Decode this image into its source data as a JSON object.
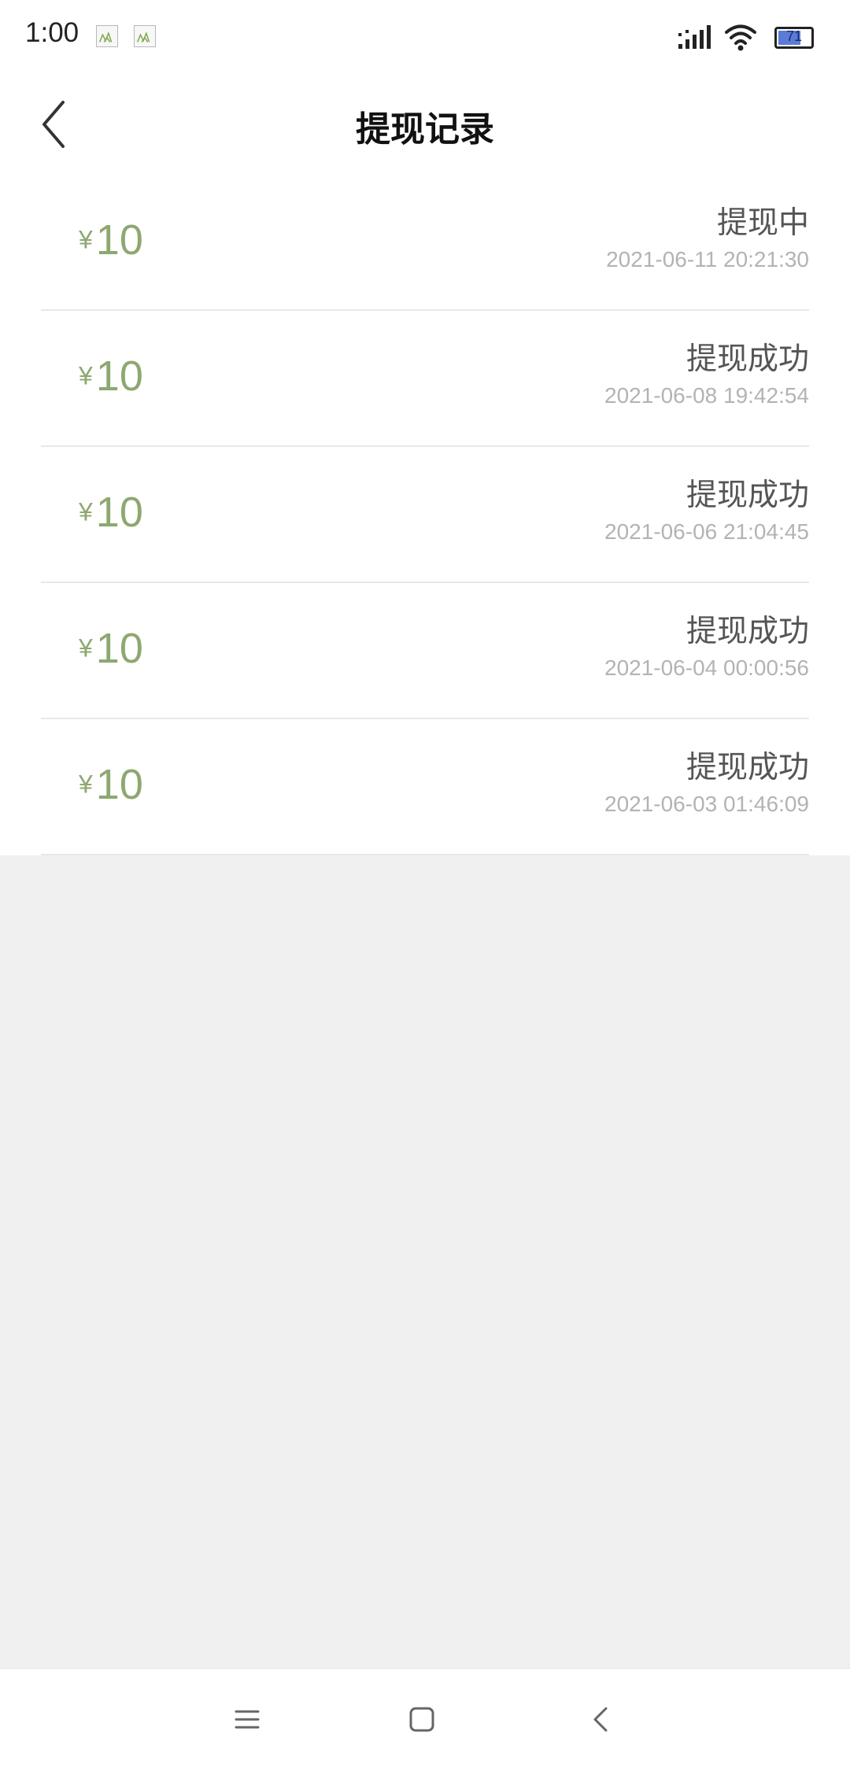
{
  "status_bar": {
    "time": "1:00",
    "battery": "71",
    "battery_level": 0.71,
    "notification_icons": [
      "image-icon",
      "image-icon"
    ],
    "signal_icon": "signal-icon",
    "wifi_icon": "wifi-icon"
  },
  "header": {
    "title": "提现记录",
    "back_icon": "chevron-left-icon"
  },
  "records": [
    {
      "currency": "¥",
      "amount": "10",
      "status": "提现中",
      "time": "2021-06-11 20:21:30"
    },
    {
      "currency": "¥",
      "amount": "10",
      "status": "提现成功",
      "time": "2021-06-08 19:42:54"
    },
    {
      "currency": "¥",
      "amount": "10",
      "status": "提现成功",
      "time": "2021-06-06 21:04:45"
    },
    {
      "currency": "¥",
      "amount": "10",
      "status": "提现成功",
      "time": "2021-06-04 00:00:56"
    },
    {
      "currency": "¥",
      "amount": "10",
      "status": "提现成功",
      "time": "2021-06-03 01:46:09"
    }
  ],
  "nav": {
    "menu_icon": "menu-icon",
    "home_icon": "square-home-icon",
    "back_icon": "triangle-back-icon"
  },
  "colors": {
    "amount": "#8da870",
    "background": "#f0f0f0"
  }
}
